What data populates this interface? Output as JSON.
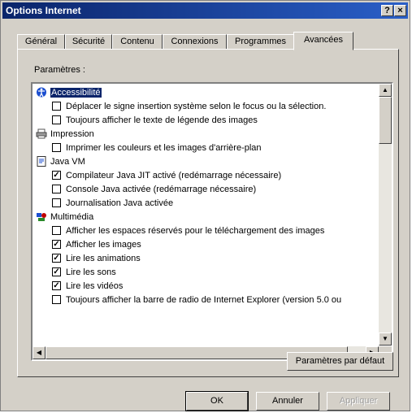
{
  "window": {
    "title": "Options Internet",
    "help_label": "?",
    "close_label": "×"
  },
  "tabs": [
    {
      "label": "Général"
    },
    {
      "label": "Sécurité"
    },
    {
      "label": "Contenu"
    },
    {
      "label": "Connexions"
    },
    {
      "label": "Programmes"
    },
    {
      "label": "Avancées",
      "active": true
    }
  ],
  "settings": {
    "label": "Paramètres :",
    "categories": [
      {
        "name": "Accessibilité",
        "icon": "accessibility-icon",
        "selected": true,
        "items": [
          {
            "text": "Déplacer le signe insertion système selon le focus ou la sélection.",
            "checked": false
          },
          {
            "text": "Toujours afficher le texte de légende des images",
            "checked": false
          }
        ]
      },
      {
        "name": "Impression",
        "icon": "printer-icon",
        "items": [
          {
            "text": "Imprimer les couleurs et les images d'arrière-plan",
            "checked": false
          }
        ]
      },
      {
        "name": "Java VM",
        "icon": "java-document-icon",
        "items": [
          {
            "text": "Compilateur Java JIT activé (redémarrage nécessaire)",
            "checked": true
          },
          {
            "text": "Console Java activée (redémarrage nécessaire)",
            "checked": false
          },
          {
            "text": "Journalisation Java activée",
            "checked": false
          }
        ]
      },
      {
        "name": "Multimédia",
        "icon": "multimedia-icon",
        "items": [
          {
            "text": "Afficher les espaces réservés pour le téléchargement des images",
            "checked": false
          },
          {
            "text": "Afficher les images",
            "checked": true
          },
          {
            "text": "Lire les animations",
            "checked": true
          },
          {
            "text": "Lire les sons",
            "checked": true
          },
          {
            "text": "Lire les vidéos",
            "checked": true
          },
          {
            "text": "Toujours afficher la barre de radio de Internet Explorer (version 5.0 ou",
            "checked": false
          }
        ]
      }
    ]
  },
  "buttons": {
    "defaults": "Paramètres par défaut",
    "ok": "OK",
    "cancel": "Annuler",
    "apply": "Appliquer"
  }
}
